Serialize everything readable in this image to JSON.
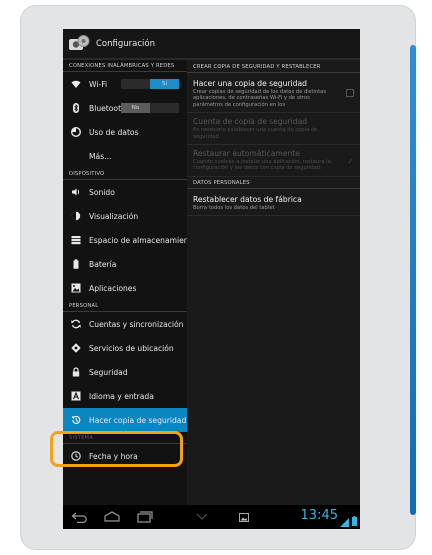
{
  "app": {
    "title": "Configuración"
  },
  "sidebar": {
    "sections": [
      {
        "header": "CONEXIONES INALÁMBRICAS Y REDES"
      },
      {
        "header": "DISPOSITIVO"
      },
      {
        "header": "PERSONAL"
      },
      {
        "header": "SISTEMA"
      }
    ],
    "wifi": {
      "label": "Wi-Fi",
      "toggle": "Sí"
    },
    "bluetooth": {
      "label": "Bluetooth",
      "toggle": "No"
    },
    "items": {
      "data_usage": "Uso de datos",
      "more": "Más...",
      "sound": "Sonido",
      "display": "Visualización",
      "storage": "Espacio de almacenamiento",
      "battery": "Batería",
      "apps": "Aplicaciones",
      "accounts": "Cuentas y sincronización",
      "location": "Servicios de ubicación",
      "security": "Seguridad",
      "language": "Idioma y entrada",
      "backup": "Hacer copia de seguridad",
      "datetime": "Fecha y hora"
    }
  },
  "detail": {
    "header_backup": "CREAR COPIA DE SEGURIDAD Y RESTABLECER",
    "backup": {
      "title": "Hacer una copia de seguridad",
      "summary": "Crear copias de seguridad de los datos de distintas aplicaciones, de contraseñas Wi-Fi y de otros parámetros de configuración en los"
    },
    "backup_account": {
      "title": "Cuenta de copia de seguridad",
      "summary": "Es necesario establecer una cuenta de copia de seguridad."
    },
    "auto_restore": {
      "title": "Restaurar automáticamente",
      "summary": "Cuando vuelvas a instalar una aplicación, restaura la configuración y los datos con copia de seguridad."
    },
    "header_personal": "DATOS PERSONALES",
    "factory_reset": {
      "title": "Restablecer datos de fábrica",
      "summary": "Borra todos los datos del tablet"
    }
  },
  "status": {
    "time": "13:45"
  },
  "colors": {
    "accent": "#33b5e5",
    "selected": "#0c86bf",
    "highlight": "#f2a419"
  }
}
